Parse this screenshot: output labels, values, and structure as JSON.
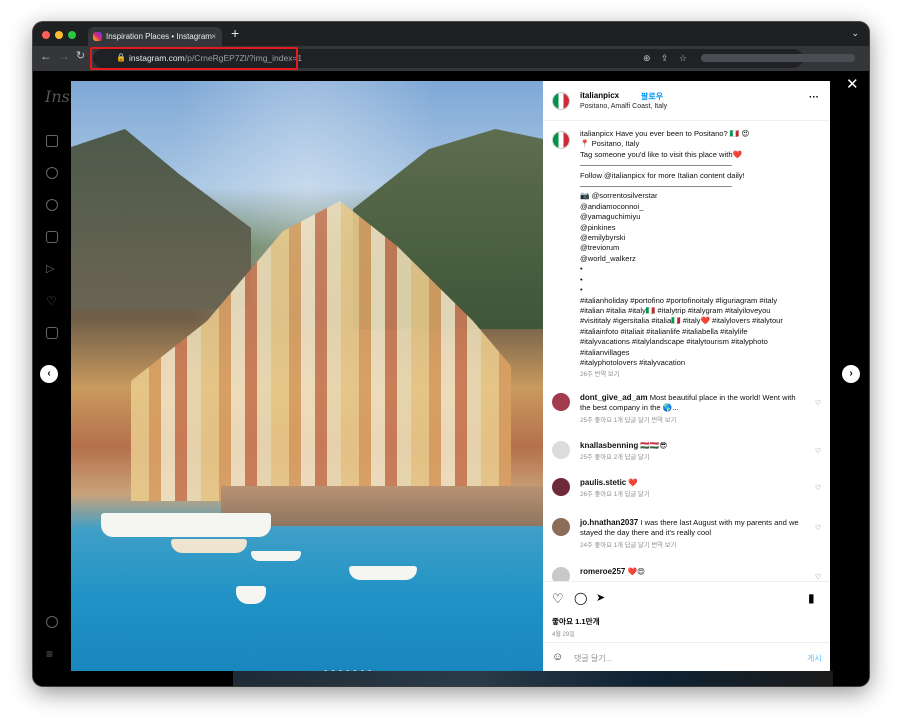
{
  "browser": {
    "tab_title": "Inspiration Places • Instagram",
    "tab_close": "×",
    "new_tab": "+",
    "url_host": "instagram.com",
    "url_path": "/p/CrneRgEP7Zl/?img_index=1"
  },
  "sidebar": {
    "logo_text": "Insta"
  },
  "post": {
    "username": "italianpicx",
    "follow_label": "팔로우",
    "location": "Positano, Amalfi Coast, Italy",
    "more": "···",
    "caption_lines": [
      "italianpicx Have you ever been to Positano? 🇮🇹 😍",
      "📍 Positano, Italy",
      "Tag someone you'd like to visit this place with❤️",
      "————————————————————",
      "Follow @italianpicx for more Italian content daily!",
      "————————————————————",
      "📷 @sorrentosilverstar",
      "@andiamoconnoi_",
      "@yamaguchimiyu",
      "@pinkines",
      "@emilybyrski",
      "@treviorum",
      "@world_walkerz",
      "•",
      "•",
      "•",
      "#italianholiday #portofino #portofinoitaly #liguriagram #italy",
      "#italian #italia #italy🇮🇹 #italytrip #italygram #italyiloveyou",
      "#visititaly #igersitalia #italia🇮🇹 #italy❤️ #italylovers #italytour",
      "#italiainfoto #italiait #italianlife #italiabella #italylife",
      "#italyvacations #italylandscape #italytourism #italyphoto",
      "#italianvillages",
      "#italyphotolovers #italyvacation"
    ],
    "caption_meta": "26주   번역 보기",
    "comments": [
      {
        "user": "dont_give_ad_am",
        "text": "Most beautiful place in the world! Went with the best company in the 🌎...",
        "meta": "25주   좋아요 1개   답글 달기   번역 보기",
        "color": "#a23b4e"
      },
      {
        "user": "knallasbenning",
        "text": "🇭🇺🇭🇺😎",
        "meta": "25주   좋아요 2개   답글 달기",
        "color": "#dcdcdc"
      },
      {
        "user": "paulis.stetic",
        "text": "❤️",
        "meta": "26주   좋아요 1개   답글 달기",
        "color": "#6e2a3a"
      },
      {
        "user": "jo.hnathan2037",
        "text": "I was there last August with my parents and we stayed the day there and it's really cool",
        "meta": "24주   좋아요 1개   답글 달기   번역 보기",
        "color": "#8c6d5a"
      },
      {
        "user": "romeroe257",
        "text": "❤️😍",
        "meta": "",
        "color": "#c9c9c9"
      }
    ],
    "likes": "좋아요 1.1만개",
    "date": "4월 29일",
    "comment_placeholder": "댓글 달기...",
    "post_label": "게시"
  },
  "icons": {
    "heart": "♡",
    "comment": "◯",
    "share": "➤",
    "save": "▮",
    "emoji": "☺",
    "close": "✕",
    "prev": "‹",
    "next": "›"
  }
}
